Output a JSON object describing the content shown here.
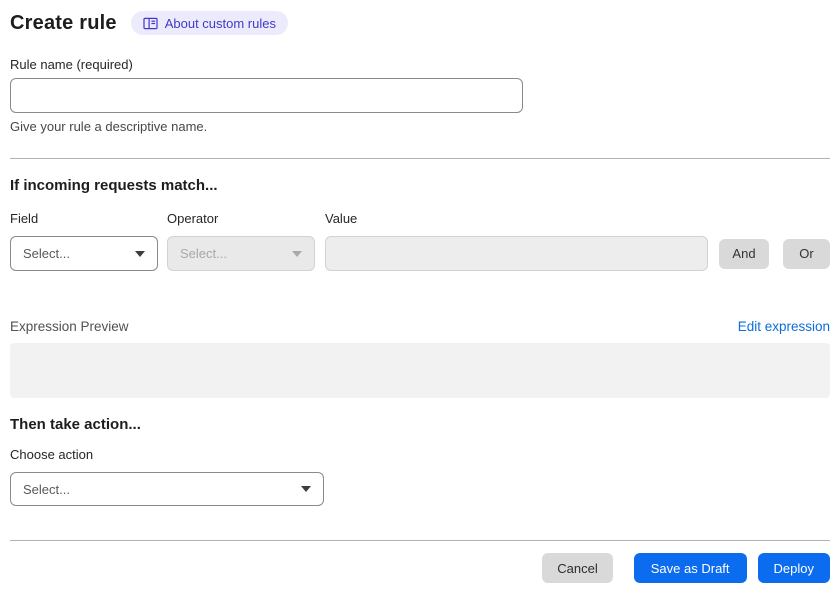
{
  "page": {
    "title": "Create rule"
  },
  "about_badge": {
    "icon": "book-icon",
    "label": "About custom rules"
  },
  "rule_name": {
    "label": "Rule name (required)",
    "value": "",
    "placeholder": "",
    "helper": "Give your rule a descriptive name."
  },
  "match": {
    "heading": "If incoming requests match...",
    "field": {
      "label": "Field",
      "selected": "Select..."
    },
    "operator": {
      "label": "Operator",
      "selected": "Select...",
      "state": "disabled"
    },
    "value": {
      "label": "Value",
      "value": "",
      "state": "disabled"
    },
    "and_label": "And",
    "or_label": "Or"
  },
  "expression": {
    "label": "Expression Preview",
    "edit_link": "Edit expression",
    "content": ""
  },
  "action": {
    "heading": "Then take action...",
    "label": "Choose action",
    "selected": "Select..."
  },
  "footer": {
    "cancel": "Cancel",
    "save_draft": "Save as Draft",
    "deploy": "Deploy"
  },
  "colors": {
    "accent_blue": "#0b6cf0",
    "link_blue": "#0d6ed9",
    "badge_bg": "#ecebfb",
    "badge_text": "#4338c9",
    "button_gray": "#d9d9d9",
    "disabled_bg": "#e9e9e9",
    "divider": "#b0b0b0"
  }
}
